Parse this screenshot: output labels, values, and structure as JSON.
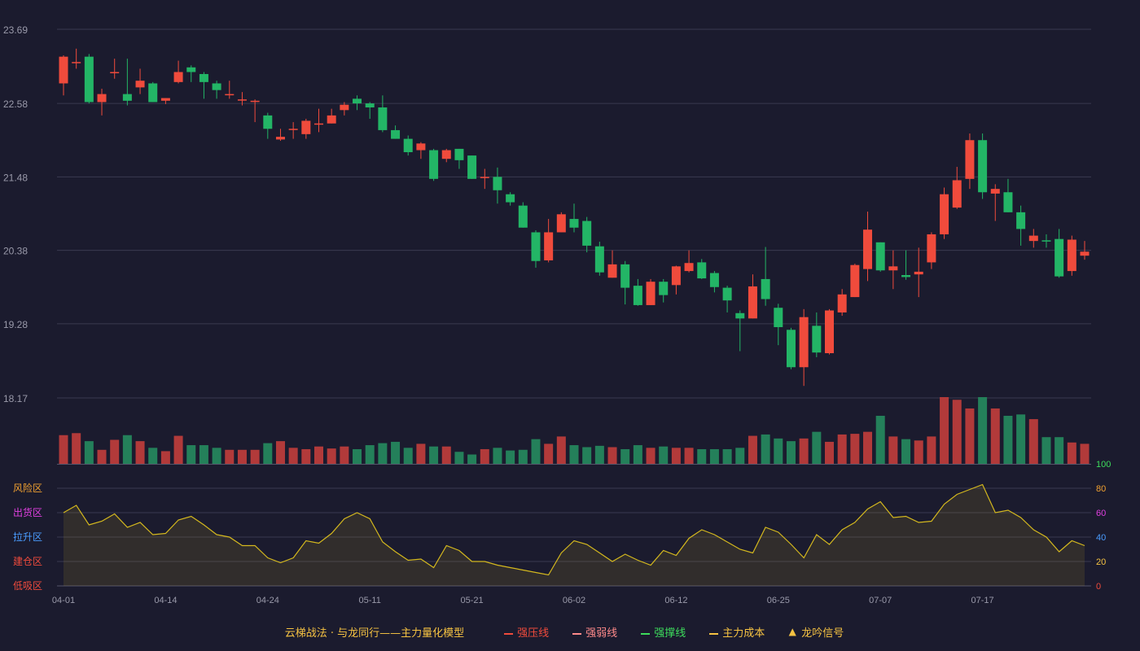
{
  "legend": {
    "title": "云梯战法 · 与龙同行——主力量化模型",
    "items": [
      {
        "label": "强压线",
        "color": "#f04b3c",
        "style": "solid"
      },
      {
        "label": "强弱线",
        "color": "#ff8a8a",
        "style": "dash"
      },
      {
        "label": "强撑线",
        "color": "#3ddc5c",
        "style": "solid"
      },
      {
        "label": "主力成本",
        "color": "#f5c242",
        "style": "dash"
      },
      {
        "label": "龙吟信号",
        "color": "#f5c242",
        "style": "triangle"
      }
    ]
  },
  "chart_data": {
    "type": "candlestick",
    "price_axis": {
      "ticks": [
        "23.69",
        "22.58",
        "21.48",
        "20.38",
        "19.28",
        "18.17"
      ],
      "min": 18.17,
      "max": 23.69
    },
    "x_tick_labels": [
      {
        "index": 0,
        "label": "04-01"
      },
      {
        "index": 8,
        "label": "04-14"
      },
      {
        "index": 16,
        "label": "04-24"
      },
      {
        "index": 24,
        "label": "05-11"
      },
      {
        "index": 32,
        "label": "05-21"
      },
      {
        "index": 40,
        "label": "06-02"
      },
      {
        "index": 48,
        "label": "06-12"
      },
      {
        "index": 56,
        "label": "06-25"
      },
      {
        "index": 64,
        "label": "07-07"
      },
      {
        "index": 72,
        "label": "07-17"
      }
    ],
    "ohlc": [
      [
        22.88,
        23.28,
        22.7,
        23.3
      ],
      [
        23.2,
        23.2,
        23.1,
        23.4
      ],
      [
        23.28,
        22.6,
        22.58,
        23.32
      ],
      [
        22.6,
        22.72,
        22.4,
        22.8
      ],
      [
        23.05,
        23.05,
        22.95,
        23.25
      ],
      [
        22.72,
        22.62,
        22.55,
        23.25
      ],
      [
        22.82,
        22.92,
        22.72,
        23.1
      ],
      [
        22.88,
        22.6,
        22.6,
        22.9
      ],
      [
        22.62,
        22.66,
        22.57,
        22.66
      ],
      [
        22.9,
        23.05,
        22.88,
        23.22
      ],
      [
        23.12,
        23.05,
        22.9,
        23.15
      ],
      [
        23.02,
        22.9,
        22.65,
        23.05
      ],
      [
        22.88,
        22.78,
        22.65,
        22.92
      ],
      [
        22.72,
        22.72,
        22.65,
        22.92
      ],
      [
        22.64,
        22.64,
        22.55,
        22.75
      ],
      [
        22.62,
        22.62,
        22.3,
        22.64
      ],
      [
        22.4,
        22.2,
        22.05,
        22.44
      ],
      [
        22.04,
        22.08,
        22.02,
        22.2
      ],
      [
        22.2,
        22.2,
        22.05,
        22.3
      ],
      [
        22.12,
        22.32,
        22.05,
        22.35
      ],
      [
        22.28,
        22.28,
        22.15,
        22.5
      ],
      [
        22.28,
        22.4,
        22.28,
        22.5
      ],
      [
        22.48,
        22.56,
        22.4,
        22.6
      ],
      [
        22.65,
        22.58,
        22.48,
        22.7
      ],
      [
        22.58,
        22.52,
        22.35,
        22.6
      ],
      [
        22.52,
        22.18,
        22.15,
        22.7
      ],
      [
        22.18,
        22.05,
        22.05,
        22.25
      ],
      [
        22.05,
        21.85,
        21.8,
        22.1
      ],
      [
        21.88,
        21.98,
        21.75,
        22.0
      ],
      [
        21.88,
        21.45,
        21.42,
        21.9
      ],
      [
        21.75,
        21.88,
        21.7,
        21.9
      ],
      [
        21.9,
        21.73,
        21.6,
        21.9
      ],
      [
        21.8,
        21.45,
        21.45,
        21.8
      ],
      [
        21.48,
        21.48,
        21.3,
        21.6
      ],
      [
        21.48,
        21.28,
        21.08,
        21.62
      ],
      [
        21.22,
        21.1,
        21.05,
        21.25
      ],
      [
        21.05,
        20.72,
        20.72,
        21.1
      ],
      [
        20.65,
        20.22,
        20.12,
        20.68
      ],
      [
        20.23,
        20.65,
        20.2,
        20.85
      ],
      [
        20.65,
        20.92,
        20.65,
        20.95
      ],
      [
        20.85,
        20.72,
        20.65,
        21.08
      ],
      [
        20.82,
        20.45,
        20.35,
        20.88
      ],
      [
        20.44,
        20.05,
        20.0,
        20.51
      ],
      [
        19.97,
        20.17,
        19.97,
        20.38
      ],
      [
        20.17,
        19.82,
        19.57,
        20.22
      ],
      [
        19.85,
        19.56,
        19.55,
        19.95
      ],
      [
        19.56,
        19.91,
        19.56,
        19.95
      ],
      [
        19.91,
        19.71,
        19.6,
        19.95
      ],
      [
        19.86,
        20.14,
        19.72,
        20.15
      ],
      [
        20.07,
        20.19,
        20.05,
        20.38
      ],
      [
        20.2,
        19.96,
        19.95,
        20.25
      ],
      [
        20.04,
        19.83,
        19.75,
        20.07
      ],
      [
        19.82,
        19.63,
        19.45,
        19.85
      ],
      [
        19.44,
        19.36,
        18.87,
        19.48
      ],
      [
        19.36,
        19.84,
        19.36,
        20.02
      ],
      [
        19.95,
        19.65,
        19.55,
        20.43
      ],
      [
        19.52,
        19.23,
        18.96,
        19.58
      ],
      [
        19.19,
        18.63,
        18.6,
        19.22
      ],
      [
        18.63,
        19.38,
        18.35,
        19.5
      ],
      [
        19.25,
        18.85,
        18.78,
        19.45
      ],
      [
        18.84,
        19.48,
        18.82,
        19.5
      ],
      [
        19.45,
        19.72,
        19.4,
        19.8
      ],
      [
        19.68,
        20.16,
        19.68,
        20.18
      ],
      [
        20.1,
        20.69,
        19.92,
        20.96
      ],
      [
        20.5,
        20.08,
        20.06,
        20.5
      ],
      [
        20.08,
        20.14,
        19.8,
        20.38
      ],
      [
        20.01,
        19.98,
        19.94,
        20.38
      ],
      [
        20.02,
        20.06,
        19.68,
        20.42
      ],
      [
        20.2,
        20.62,
        20.1,
        20.65
      ],
      [
        20.62,
        21.22,
        20.55,
        21.32
      ],
      [
        21.02,
        21.43,
        21.0,
        21.63
      ],
      [
        21.45,
        22.03,
        21.3,
        22.13
      ],
      [
        22.03,
        21.25,
        21.15,
        22.13
      ],
      [
        21.23,
        21.3,
        20.82,
        21.37
      ],
      [
        21.25,
        20.95,
        20.95,
        21.45
      ],
      [
        20.95,
        20.7,
        20.45,
        21.05
      ],
      [
        20.52,
        20.6,
        20.42,
        20.7
      ],
      [
        20.53,
        20.52,
        20.42,
        20.62
      ],
      [
        20.55,
        19.99,
        19.97,
        20.7
      ],
      [
        20.07,
        20.54,
        20.0,
        20.6
      ],
      [
        20.3,
        20.36,
        20.24,
        20.52
      ]
    ],
    "volume": [
      0.43,
      0.46,
      0.34,
      0.21,
      0.36,
      0.43,
      0.34,
      0.24,
      0.19,
      0.42,
      0.28,
      0.28,
      0.24,
      0.21,
      0.21,
      0.21,
      0.31,
      0.34,
      0.24,
      0.22,
      0.26,
      0.23,
      0.26,
      0.22,
      0.28,
      0.31,
      0.33,
      0.24,
      0.3,
      0.26,
      0.26,
      0.18,
      0.14,
      0.22,
      0.24,
      0.2,
      0.21,
      0.37,
      0.3,
      0.41,
      0.28,
      0.25,
      0.27,
      0.25,
      0.22,
      0.28,
      0.24,
      0.26,
      0.24,
      0.24,
      0.22,
      0.22,
      0.22,
      0.24,
      0.42,
      0.44,
      0.38,
      0.34,
      0.38,
      0.48,
      0.33,
      0.44,
      0.45,
      0.48,
      0.72,
      0.41,
      0.37,
      0.35,
      0.41,
      1.0,
      0.96,
      0.83,
      1.0,
      0.83,
      0.72,
      0.74,
      0.67,
      0.4,
      0.4,
      0.32,
      0.3
    ],
    "volume_up_color": "#b23a3a",
    "volume_down_color": "#24805a",
    "up_color": "#f04b3c",
    "down_color": "#23b566",
    "indicator": {
      "axis_ticks": [
        0,
        20,
        40,
        60,
        80,
        100
      ],
      "axis_tick_colors": [
        "#f04b3c",
        "#f5c242",
        "#4a9cff",
        "#e040e0",
        "#f0a030",
        "#3ddc5c"
      ],
      "zones": [
        {
          "label": "风险区",
          "color": "#f0a030"
        },
        {
          "label": "出货区",
          "color": "#e040e0"
        },
        {
          "label": "拉升区",
          "color": "#4a9cff"
        },
        {
          "label": "建仓区",
          "color": "#f04b3c"
        },
        {
          "label": "低吸区",
          "color": "#f04b3c"
        }
      ],
      "line_color": "#d4b81e",
      "values": [
        60,
        66,
        50,
        53,
        59,
        48,
        52,
        42,
        43,
        54,
        57,
        50,
        42,
        40,
        33,
        33,
        23,
        19,
        23,
        37,
        35,
        43,
        55,
        60,
        55,
        36,
        28,
        21,
        22,
        15,
        33,
        29,
        20,
        20,
        17,
        15,
        13,
        11,
        9,
        27,
        37,
        34,
        27,
        20,
        26,
        21,
        17,
        29,
        25,
        39,
        46,
        42,
        36,
        30,
        27,
        48,
        44,
        34,
        23,
        42,
        34,
        46,
        52,
        63,
        69,
        56,
        57,
        52,
        53,
        67,
        75,
        79,
        83,
        60,
        62,
        56,
        46,
        40,
        28,
        37,
        33
      ]
    }
  }
}
